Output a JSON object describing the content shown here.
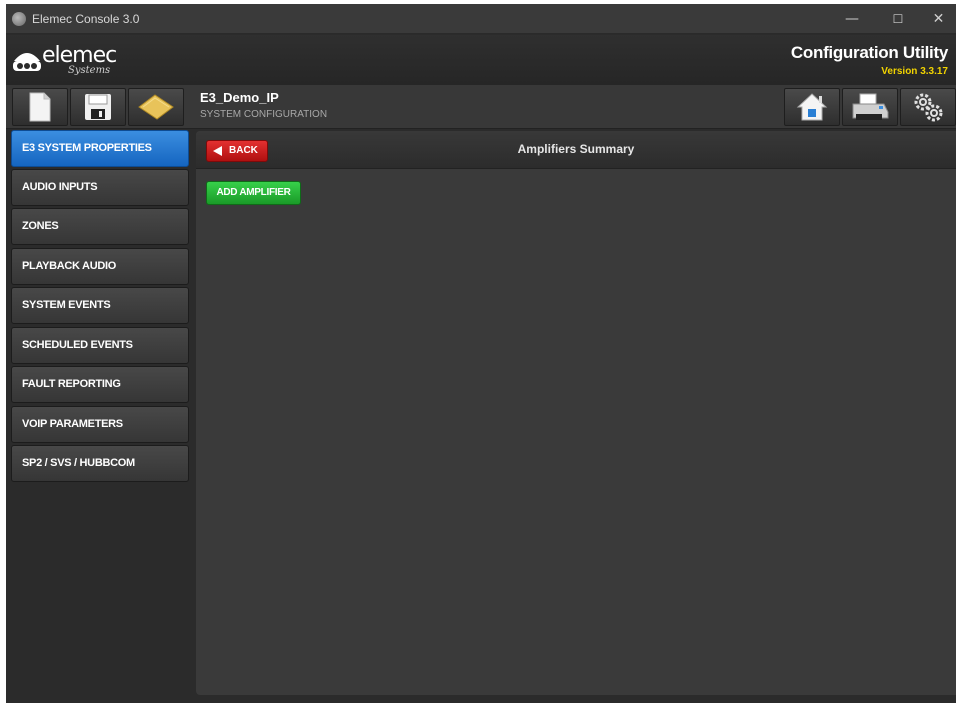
{
  "window": {
    "title": "Elemec Console 3.0",
    "controls": {
      "minimize": "—",
      "maximize": "☐",
      "close": "✕"
    }
  },
  "header": {
    "logo_text": "elemec",
    "logo_sub": "Systems",
    "app_title": "Configuration Utility",
    "version": "Version 3.3.17"
  },
  "toolbar": {
    "project_name": "E3_Demo_IP",
    "project_sub": "SYSTEM CONFIGURATION",
    "left_icons": [
      "new-document-icon",
      "save-icon",
      "open-folder-icon"
    ],
    "right_icons": [
      "home-icon",
      "printer-icon",
      "settings-icon"
    ]
  },
  "sidebar": {
    "items": [
      {
        "label": "E3 SYSTEM PROPERTIES",
        "active": true
      },
      {
        "label": "AUDIO INPUTS",
        "active": false
      },
      {
        "label": "ZONES",
        "active": false
      },
      {
        "label": "PLAYBACK AUDIO",
        "active": false
      },
      {
        "label": "SYSTEM EVENTS",
        "active": false
      },
      {
        "label": "SCHEDULED EVENTS",
        "active": false
      },
      {
        "label": "FAULT REPORTING",
        "active": false
      },
      {
        "label": "VOIP PARAMETERS",
        "active": false
      },
      {
        "label": "SP2 / SVS / HUBBCOM",
        "active": false
      }
    ]
  },
  "main": {
    "back_label": "BACK",
    "title": "Amplifiers Summary",
    "add_label": "ADD AMPLIFIER"
  },
  "colors": {
    "active_nav": "#1e74d2",
    "back_button": "#d02020",
    "add_button": "#28b838",
    "version_text": "#f2d400"
  }
}
